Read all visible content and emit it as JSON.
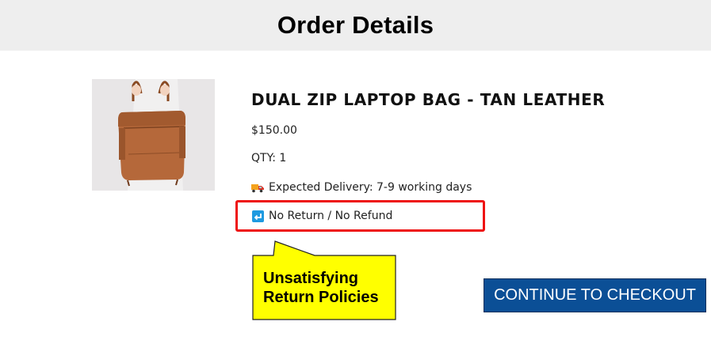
{
  "header": {
    "title": "Order Details"
  },
  "product": {
    "title": "DUAL ZIP LAPTOP BAG - TAN LEATHER",
    "price": "$150.00",
    "qty": "QTY: 1",
    "delivery": "Expected Delivery: 7-9 working days",
    "returns": "No Return / No Refund"
  },
  "callout": {
    "line1": "Unsatisfying",
    "line2": "Return Policies"
  },
  "checkout": {
    "label": "CONTINUE TO CHECKOUT"
  },
  "icons": {
    "delivery": "delivery-truck-icon",
    "returns": "return-arrow-icon"
  },
  "colors": {
    "header_bg": "#eeeeee",
    "highlight": "#ee1111",
    "callout_bg": "#ffff00",
    "button_bg": "#0b4f96"
  }
}
